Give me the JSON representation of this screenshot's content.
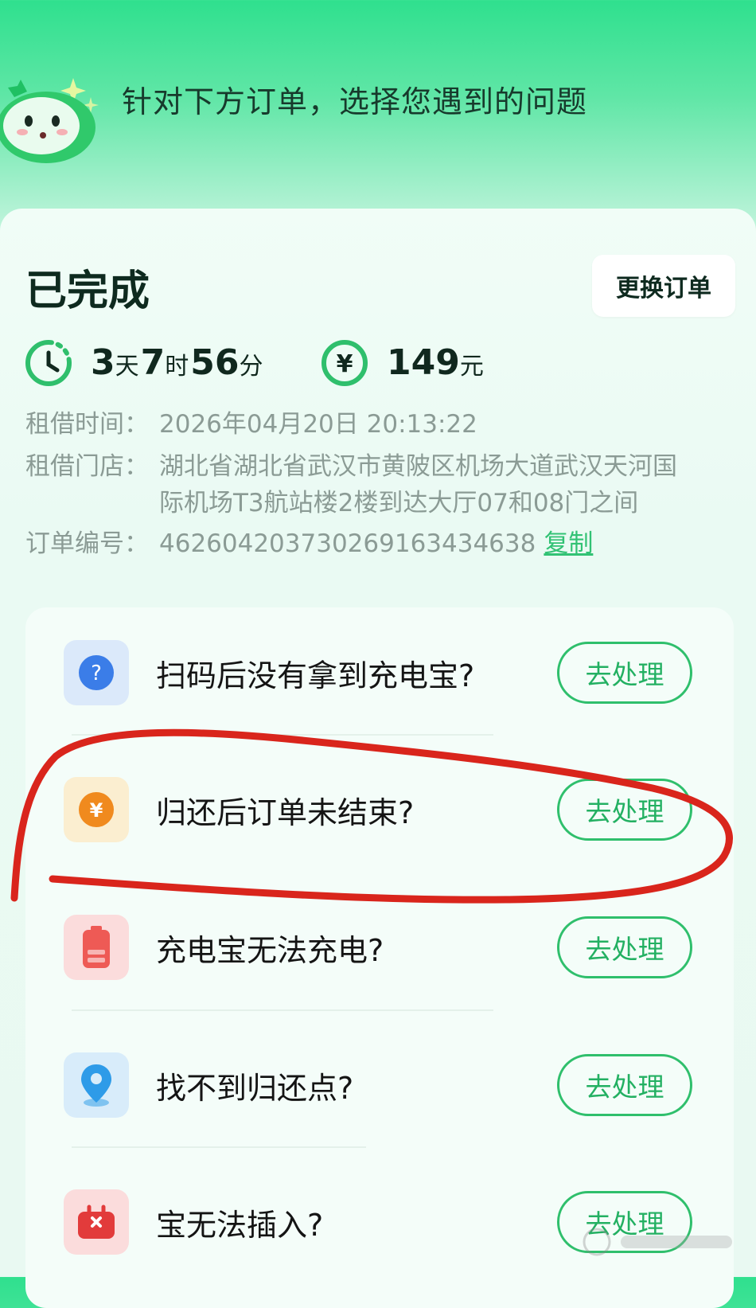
{
  "header": {
    "title": "针对下方订单，选择您遇到的问题",
    "mascot": "green-mascot"
  },
  "order": {
    "status": "已完成",
    "change_order_label": "更换订单",
    "duration": {
      "days": "3",
      "days_unit": "天",
      "hours": "7",
      "hours_unit": "时",
      "minutes": "56",
      "minutes_unit": "分"
    },
    "amount": {
      "value": "149",
      "unit": "元"
    },
    "info": [
      {
        "label": "租借时间：",
        "value": "2026年04月20日 20:13:22"
      },
      {
        "label": "租借门店：",
        "value_line1": "湖北省湖北省武汉市黄陂区机场大道武汉天河国",
        "value_line2": "际机场T3航站楼2楼到达大厅07和08门之间"
      },
      {
        "label": "订单编号：",
        "value": "4626042037302691634346​38",
        "copy_label": "复制"
      }
    ]
  },
  "issues": [
    {
      "icon": "question-icon",
      "label": "扫码后没有拿到充电宝?",
      "action": "去处理",
      "icon_bg": "#dbe9fa",
      "icon_color": "#3b7de8"
    },
    {
      "icon": "yuan-coin-icon",
      "label": "归还后订单未结束?",
      "action": "去处理",
      "icon_bg": "#fbeed0",
      "icon_color": "#f08a1e"
    },
    {
      "icon": "battery-icon",
      "label": "充电宝无法充电?",
      "action": "去处理",
      "icon_bg": "#fbdcdc",
      "icon_color": "#ee5a55"
    },
    {
      "icon": "location-pin-icon",
      "label": "找不到归还点?",
      "action": "去处理",
      "icon_bg": "#d8ecfa",
      "icon_color": "#2e9be8"
    },
    {
      "icon": "plug-box-icon",
      "label": "宝无法插入?",
      "action": "去处理",
      "icon_bg": "#fbdcdc",
      "icon_color": "#e23b3b"
    }
  ],
  "colors": {
    "accent": "#2fbf6c",
    "annotation_red": "#d9251c"
  }
}
